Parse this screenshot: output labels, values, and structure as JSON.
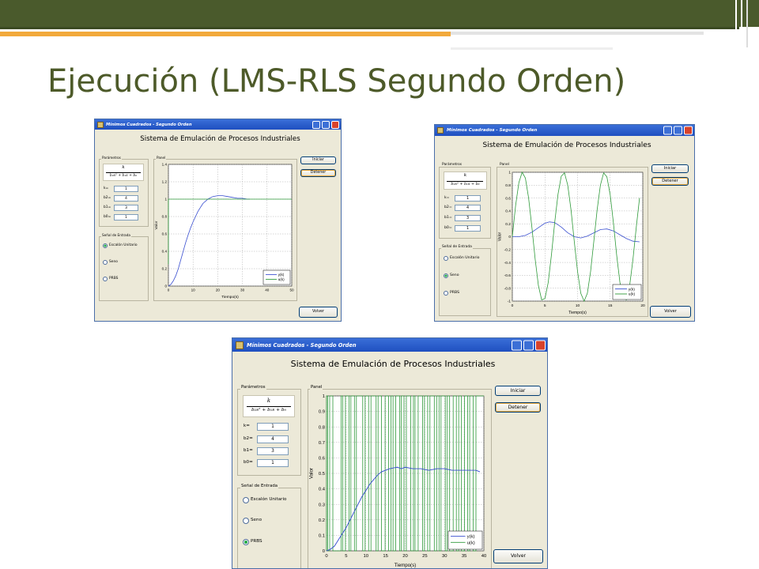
{
  "slide": {
    "title": "Ejecución (LMS-RLS Segundo Orden)",
    "colors": {
      "bar": "#4a5a2c",
      "title": "#4d5a29",
      "accent": "#f2a93b"
    }
  },
  "windows": [
    {
      "id": "w1",
      "window_title": "Mínimos  Cuadrados - Segundo Orden",
      "heading": "Sistema de Emulación de Procesos Industriales",
      "param_group_label": "Parámetros",
      "formula": {
        "numerator": "k",
        "denominator": "b₂s² + b₁s + b₀"
      },
      "params": [
        {
          "label": "k=",
          "value": "1"
        },
        {
          "label": "b2=",
          "value": "4"
        },
        {
          "label": "b1=",
          "value": "3"
        },
        {
          "label": "b0=",
          "value": "1"
        }
      ],
      "signal_group_label": "Señal de Entrada",
      "radios": [
        {
          "label": "Escalón Unitario",
          "selected": true
        },
        {
          "label": "Seno",
          "selected": false
        },
        {
          "label": "PRBS",
          "selected": false
        }
      ],
      "panel_label": "Panel",
      "buttons": {
        "start": "Iniciar",
        "stop": "Detener",
        "back": "Volver"
      },
      "chart_data": {
        "type": "line",
        "xlabel": "Tiempo(s)",
        "ylabel": "Valor",
        "xlim": [
          0,
          50
        ],
        "ylim": [
          0,
          1.4
        ],
        "xticks": [
          "0",
          "10",
          "20",
          "30",
          "40",
          "50"
        ],
        "yticks": [
          "0",
          "0.2",
          "0.4",
          "0.6",
          "0.8",
          "1",
          "1.2",
          "1.4"
        ],
        "grid": true,
        "legend_position": "bottom-right",
        "series": [
          {
            "name": "y(k)",
            "color": "#3a4fd0",
            "x": [
              0,
              1,
              2,
              3,
              4,
              5,
              6,
              7,
              8,
              9,
              10,
              12,
              14,
              16,
              18,
              20,
              22,
              24,
              26,
              28,
              30,
              32,
              33
            ],
            "y": [
              0,
              0.02,
              0.06,
              0.12,
              0.2,
              0.3,
              0.4,
              0.5,
              0.59,
              0.67,
              0.74,
              0.86,
              0.95,
              1.0,
              1.03,
              1.04,
              1.04,
              1.03,
              1.02,
              1.01,
              1.01,
              1.0,
              1.0
            ]
          },
          {
            "name": "u(k)",
            "color": "#2f9a3a",
            "x": [
              0,
              0,
              50
            ],
            "y": [
              0.25,
              1,
              1
            ]
          }
        ]
      }
    },
    {
      "id": "w2",
      "window_title": "Mínimos  Cuadrados - Segundo Orden",
      "heading": "Sistema de Emulación de Procesos Industriales",
      "param_group_label": "Parámetros",
      "formula": {
        "numerator": "k",
        "denominator": "b₂s² + b₁s + b₀"
      },
      "params": [
        {
          "label": "k=",
          "value": "1"
        },
        {
          "label": "b2=",
          "value": "4"
        },
        {
          "label": "b1=",
          "value": "3"
        },
        {
          "label": "b0=",
          "value": "1"
        }
      ],
      "signal_group_label": "Señal de Entrada",
      "radios": [
        {
          "label": "Escalón Unitario",
          "selected": false
        },
        {
          "label": "Seno",
          "selected": true
        },
        {
          "label": "PRBS",
          "selected": false
        }
      ],
      "panel_label": "Panel",
      "buttons": {
        "start": "Iniciar",
        "stop": "Detener",
        "back": "Volver"
      },
      "chart_data": {
        "type": "line",
        "xlabel": "Tiempo(s)",
        "ylabel": "Valor",
        "xlim": [
          0,
          20
        ],
        "ylim": [
          -1,
          1
        ],
        "xticks": [
          "0",
          "5",
          "10",
          "15",
          "20"
        ],
        "yticks": [
          "-1",
          "-0.8",
          "-0.6",
          "-0.4",
          "-0.2",
          "0",
          "0.2",
          "0.4",
          "0.6",
          "0.8",
          "1"
        ],
        "grid": true,
        "legend_position": "bottom-right",
        "series": [
          {
            "name": "y(k)",
            "color": "#3a4fd0",
            "x": [
              0,
              1,
              2,
              3,
              4,
              5,
              5.7,
              6.5,
              7.5,
              8.5,
              9.5,
              10.5,
              11.5,
              12.5,
              13.5,
              14.5,
              15.5,
              16.5,
              17.5,
              18.5,
              19.5
            ],
            "y": [
              0,
              0.0,
              0.02,
              0.07,
              0.14,
              0.21,
              0.23,
              0.22,
              0.15,
              0.06,
              0.0,
              -0.02,
              0.01,
              0.06,
              0.11,
              0.12,
              0.09,
              0.03,
              -0.03,
              -0.07,
              -0.08
            ]
          },
          {
            "name": "u(k)",
            "color": "#2f9a3a",
            "x": [
              0,
              0.5,
              1,
              1.5,
              2,
              2.5,
              3,
              3.5,
              4,
              4.5,
              5,
              5.5,
              6,
              6.5,
              7,
              7.5,
              8,
              8.5,
              9,
              9.5,
              10,
              10.5,
              11,
              11.5,
              12,
              12.5,
              13,
              13.5,
              14,
              14.5,
              15,
              15.5,
              16,
              16.5,
              17,
              17.5,
              18,
              18.5,
              19,
              19.5
            ],
            "y": [
              0,
              0.48,
              0.84,
              1.0,
              0.91,
              0.6,
              0.14,
              -0.35,
              -0.76,
              -0.98,
              -0.96,
              -0.71,
              -0.28,
              0.22,
              0.66,
              0.94,
              0.99,
              0.8,
              0.41,
              -0.08,
              -0.54,
              -0.88,
              -1.0,
              -0.88,
              -0.54,
              -0.07,
              0.42,
              0.8,
              0.99,
              0.93,
              0.65,
              0.21,
              -0.29,
              -0.71,
              -0.96,
              -0.98,
              -0.75,
              -0.35,
              0.15,
              0.6
            ]
          }
        ]
      }
    },
    {
      "id": "w3",
      "window_title": "Mínimos  Cuadrados - Segundo Orden",
      "heading": "Sistema de Emulación de Procesos Industriales",
      "param_group_label": "Parámetros",
      "formula": {
        "numerator": "k",
        "denominator": "b₂s² + b₁s + b₀"
      },
      "params": [
        {
          "label": "k=",
          "value": "1"
        },
        {
          "label": "b2=",
          "value": "4"
        },
        {
          "label": "b1=",
          "value": "3"
        },
        {
          "label": "b0=",
          "value": "1"
        }
      ],
      "signal_group_label": "Señal de Entrada",
      "radios": [
        {
          "label": "Escalón Unitario",
          "selected": false
        },
        {
          "label": "Seno",
          "selected": false
        },
        {
          "label": "PRBS",
          "selected": true
        }
      ],
      "panel_label": "Panel",
      "buttons": {
        "start": "Iniciar",
        "stop": "Detener",
        "back": "Volver"
      },
      "chart_data": {
        "type": "line",
        "xlabel": "Tiempo(s)",
        "ylabel": "Valor",
        "xlim": [
          0,
          40
        ],
        "ylim": [
          0,
          1
        ],
        "xticks": [
          "0",
          "5",
          "10",
          "15",
          "20",
          "25",
          "30",
          "35",
          "40"
        ],
        "yticks": [
          "0",
          "0.1",
          "0.2",
          "0.3",
          "0.4",
          "0.5",
          "0.6",
          "0.7",
          "0.8",
          "0.9",
          "1"
        ],
        "grid": true,
        "legend_position": "bottom-right",
        "series": [
          {
            "name": "y(k)",
            "color": "#3a4fd0",
            "x": [
              0,
              1,
              2,
              3,
              4,
              5,
              6,
              7,
              8,
              9,
              10,
              11,
              12,
              13,
              14,
              15,
              16,
              17,
              18,
              19,
              20,
              22,
              24,
              26,
              28,
              30,
              32,
              34,
              36,
              38,
              39
            ],
            "y": [
              0,
              0.01,
              0.03,
              0.07,
              0.11,
              0.15,
              0.2,
              0.25,
              0.3,
              0.35,
              0.39,
              0.43,
              0.46,
              0.49,
              0.51,
              0.52,
              0.53,
              0.535,
              0.54,
              0.53,
              0.54,
              0.53,
              0.53,
              0.52,
              0.53,
              0.53,
              0.52,
              0.52,
              0.52,
              0.52,
              0.51
            ]
          },
          {
            "name": "u(k)",
            "color": "#2f9a3a",
            "switch_times": [
              0.3,
              0.8,
              1.6,
              3.7,
              4.1,
              4.8,
              5.7,
              6.2,
              7.1,
              7.6,
              9.2,
              9.8,
              10.7,
              11.3,
              12.6,
              13.1,
              14.0,
              14.9,
              15.8,
              16.4,
              16.9,
              17.6,
              18.6,
              19.0,
              19.7,
              20.3,
              21.4,
              22.1,
              22.5,
              23.3,
              24.4,
              24.9,
              25.7,
              26.3,
              27.4,
              28.0,
              28.6,
              29.1,
              30.2,
              30.7,
              31.3,
              32.2,
              33.0,
              33.6,
              34.3,
              35.1,
              35.9,
              36.4,
              37.3,
              38.0
            ],
            "low": 0,
            "high": 1
          }
        ]
      }
    }
  ]
}
